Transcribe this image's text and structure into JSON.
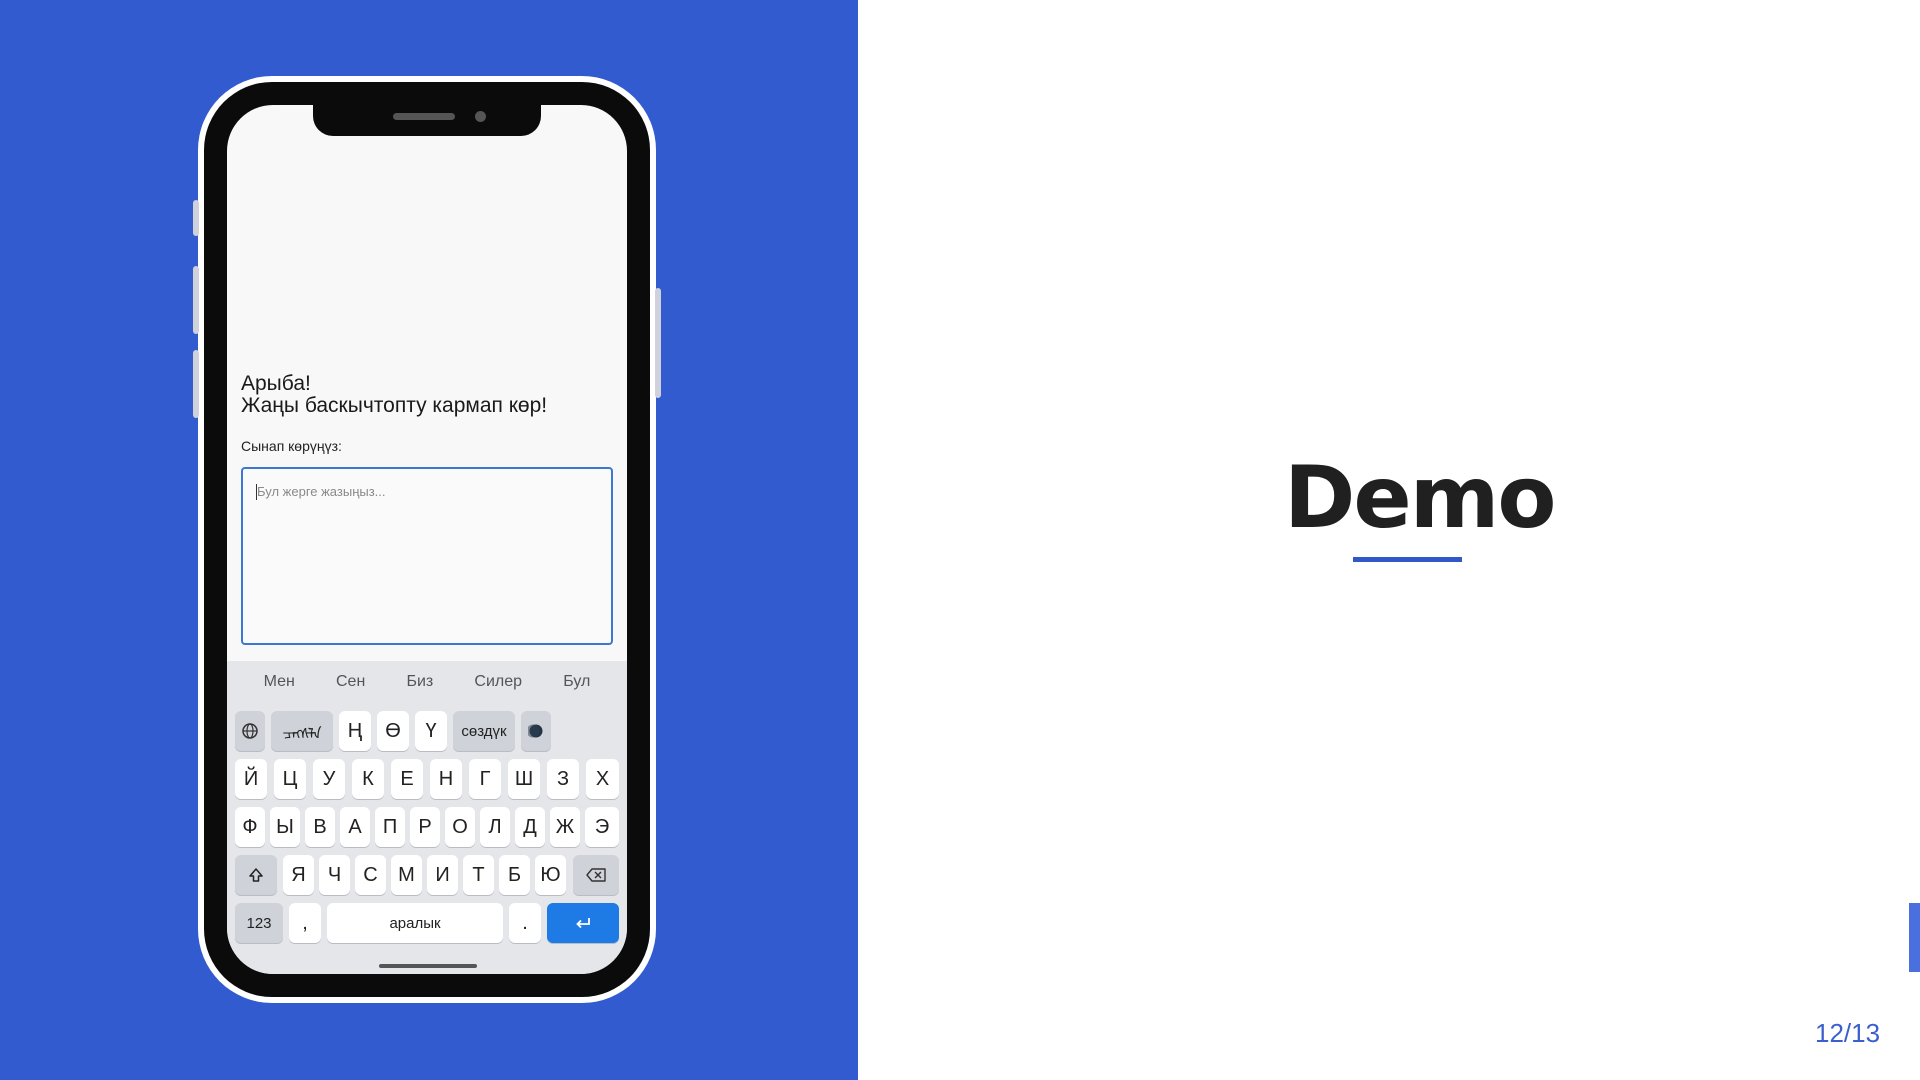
{
  "slide": {
    "title": "Demo",
    "page_number": "12/13",
    "colors": {
      "left_bg": "#335bd0",
      "accent": "#3158c8",
      "title": "#202020"
    }
  },
  "phone": {
    "greeting": [
      "Арыба!",
      "Жаңы баскычтопту кармап көр!"
    ],
    "prompt_label": "Сынап көрүңүз:",
    "input_placeholder": "Бул жерге жазыңыз...",
    "keyboard": {
      "suggestions": [
        "Мен",
        "Сен",
        "Биз",
        "Силер",
        "Бул"
      ],
      "row1": {
        "globe_icon": "globe-icon",
        "script_key": "ᠴᠨᠬᠰᠯᠠ",
        "letters": [
          "Ң",
          "Ө",
          "Ү"
        ],
        "dict_key": "сөздүк",
        "theme_icon": "moon-icon"
      },
      "row2": [
        "Й",
        "Ц",
        "У",
        "К",
        "Е",
        "Н",
        "Г",
        "Ш",
        "З",
        "Х"
      ],
      "row3": [
        "Ф",
        "Ы",
        "В",
        "А",
        "П",
        "Р",
        "О",
        "Л",
        "Д",
        "Ж",
        "Э"
      ],
      "row4": [
        "Я",
        "Ч",
        "С",
        "М",
        "И",
        "Т",
        "Б",
        "Ю"
      ],
      "num_key": "123",
      "comma": ",",
      "space": "аралык",
      "period": "."
    }
  }
}
